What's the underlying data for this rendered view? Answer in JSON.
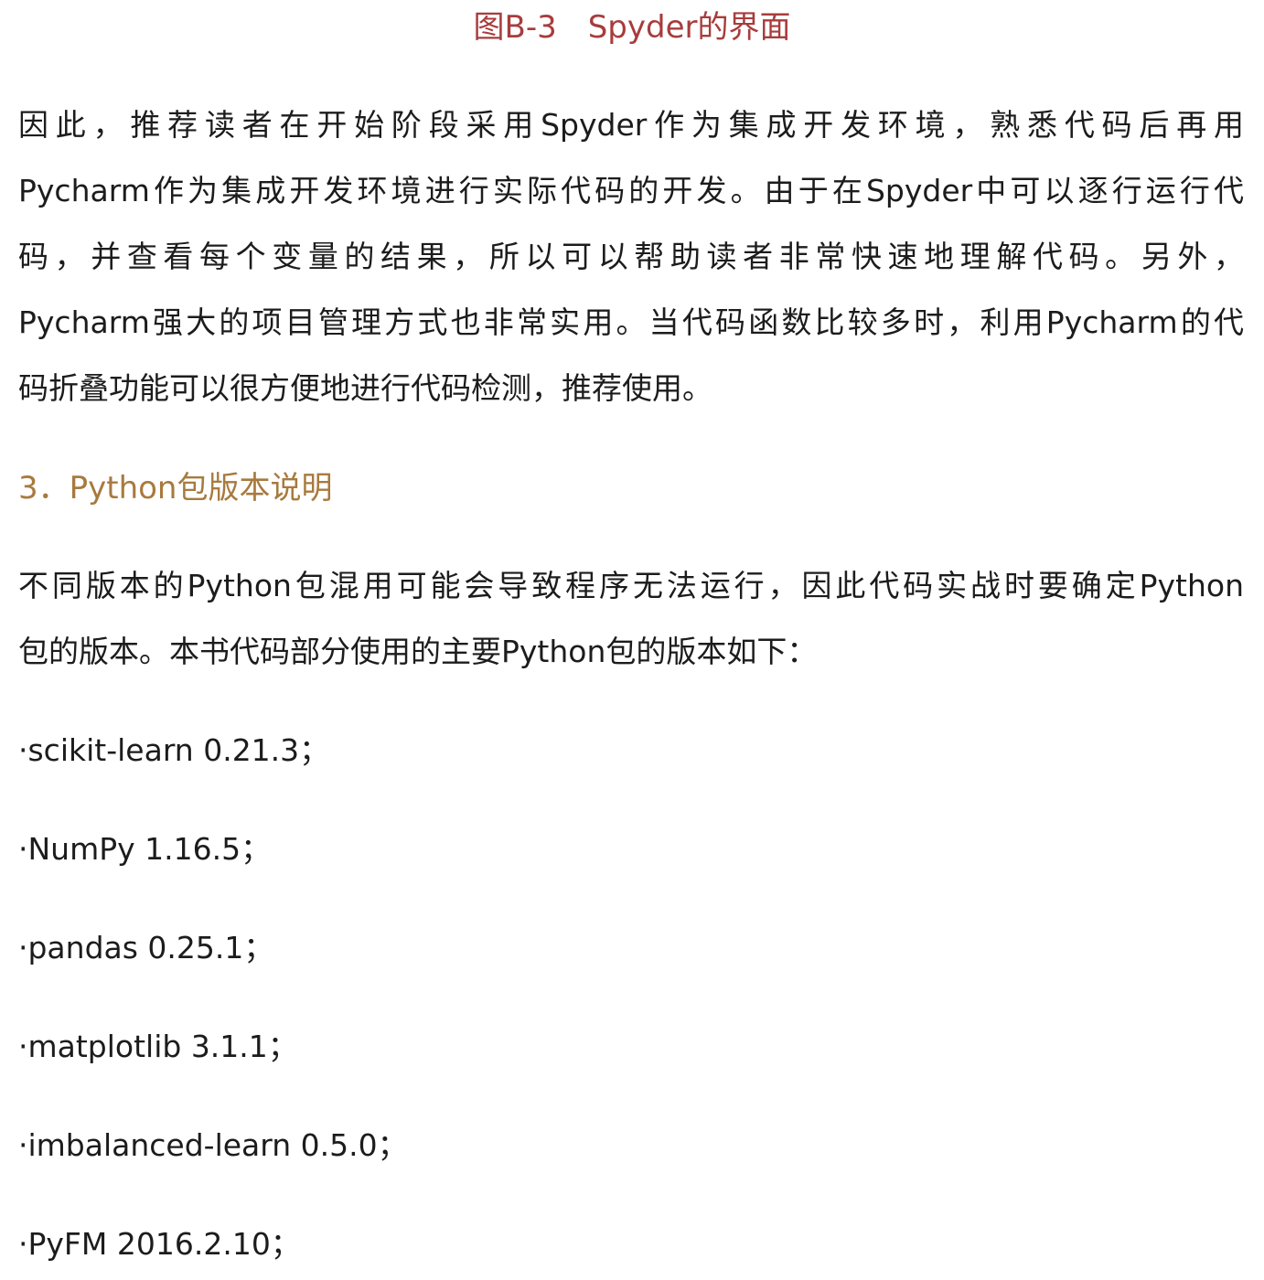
{
  "caption": "图B-3　Spyder的界面",
  "paragraph1": [
    "因此，推荐读者在开始阶段采用Spyder作为集成开发环境，熟悉代码后再用",
    "Pycharm作为集成开发环境进行实际代码的开发。由于在Spyder中可以逐行运行代",
    "码，并查看每个变量的结果，所以可以帮助读者非常快速地理解代码。另外，",
    "Pycharm强大的项目管理方式也非常实用。当代码函数比较多时，利用Pycharm的代",
    "码折叠功能可以很方便地进行代码检测，推荐使用。"
  ],
  "section_heading": "3．Python包版本说明",
  "paragraph2": [
    "不同版本的Python包混用可能会导致程序无法运行，因此代码实战时要确定Python",
    "包的版本。本书代码部分使用的主要Python包的版本如下："
  ],
  "packages": [
    "·scikit-learn 0.21.3；",
    "·NumPy 1.16.5；",
    "·pandas 0.25.1；",
    "·matplotlib 3.1.1；",
    "·imbalanced-learn 0.5.0；",
    "·PyFM 2016.2.10；"
  ],
  "colors": {
    "caption": "#a83c3c",
    "heading": "#a87a3e",
    "text": "#1c1c1c"
  }
}
